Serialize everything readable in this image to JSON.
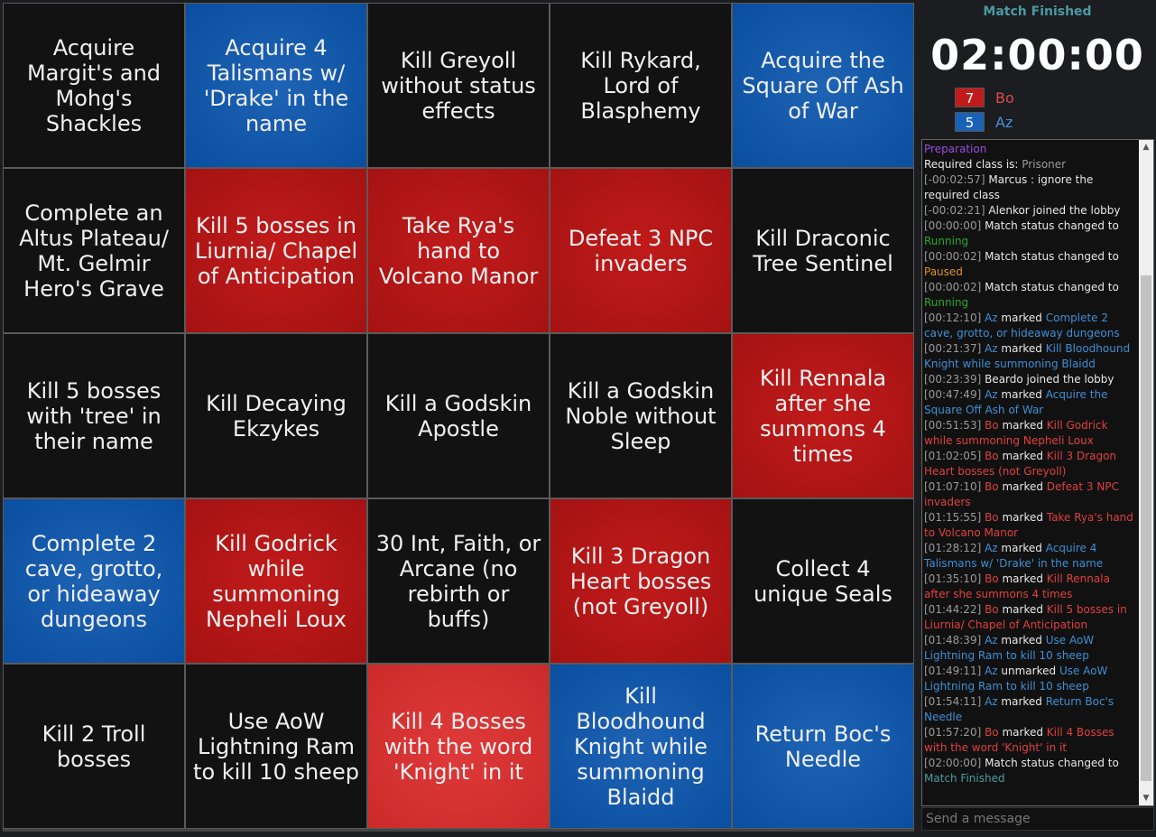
{
  "colors": {
    "red": "#c11b1b",
    "blue": "#0a4ea0",
    "none": "#121212"
  },
  "board": [
    {
      "text": "Acquire Margit's and Mohg's Shackles",
      "owner": "none"
    },
    {
      "text": "Acquire 4 Talismans w/ 'Drake' in the name",
      "owner": "blue"
    },
    {
      "text": "Kill Greyoll without status effects",
      "owner": "none"
    },
    {
      "text": "Kill Rykard, Lord of Blasphemy",
      "owner": "none"
    },
    {
      "text": "Acquire the Square Off Ash of War",
      "owner": "blue"
    },
    {
      "text": "Complete an Altus Plateau/ Mt. Gelmir Hero's Grave",
      "owner": "none"
    },
    {
      "text": "Kill 5 bosses in Liurnia/ Chapel of Anticipation",
      "owner": "red"
    },
    {
      "text": "Take Rya's hand to Volcano Manor",
      "owner": "red"
    },
    {
      "text": "Defeat 3 NPC invaders",
      "owner": "red"
    },
    {
      "text": "Kill Draconic Tree Sentinel",
      "owner": "none"
    },
    {
      "text": "Kill 5 bosses with 'tree' in their name",
      "owner": "none"
    },
    {
      "text": "Kill Decaying Ekzykes",
      "owner": "none"
    },
    {
      "text": "Kill a Godskin Apostle",
      "owner": "none"
    },
    {
      "text": "Kill a Godskin Noble without Sleep",
      "owner": "none"
    },
    {
      "text": "Kill Rennala after she summons 4 times",
      "owner": "red"
    },
    {
      "text": "Complete 2 cave, grotto, or hideaway dungeons",
      "owner": "blue"
    },
    {
      "text": "Kill Godrick while summoning Nepheli Loux",
      "owner": "red"
    },
    {
      "text": "30 Int, Faith, or Arcane (no rebirth or buffs)",
      "owner": "none"
    },
    {
      "text": "Kill 3 Dragon Heart bosses (not Greyoll)",
      "owner": "red"
    },
    {
      "text": "Collect 4 unique Seals",
      "owner": "none"
    },
    {
      "text": "Kill 2 Troll bosses",
      "owner": "none"
    },
    {
      "text": "Use AoW Lightning Ram to kill 10 sheep",
      "owner": "none"
    },
    {
      "text": "Kill 4 Bosses with the word 'Knight' in it",
      "owner": "red light"
    },
    {
      "text": "Kill Bloodhound Knight while summoning Blaidd",
      "owner": "blue"
    },
    {
      "text": "Return Boc's Needle",
      "owner": "blue"
    }
  ],
  "status": {
    "title": "Match Finished",
    "timer": "02:00:00"
  },
  "teams": {
    "bo": {
      "score": "7",
      "name": "Bo"
    },
    "az": {
      "score": "5",
      "name": "Az"
    }
  },
  "chat": {
    "placeholder": "Send a message",
    "messages": [
      {
        "parts": [
          {
            "t": "Preparation",
            "c": "prep"
          }
        ]
      },
      {
        "parts": [
          {
            "t": "Required class is: ",
            "c": ""
          },
          {
            "t": "Prisoner",
            "c": "muted"
          }
        ]
      },
      {
        "parts": [
          {
            "t": "[-00:02:57] ",
            "c": "ts"
          },
          {
            "t": "Marcus : ignore the required class",
            "c": ""
          }
        ]
      },
      {
        "parts": [
          {
            "t": "[-00:02:21] ",
            "c": "ts"
          },
          {
            "t": "Alenkor joined the lobby",
            "c": ""
          }
        ]
      },
      {
        "parts": [
          {
            "t": "[00:00:00] ",
            "c": "ts"
          },
          {
            "t": "Match status changed to ",
            "c": ""
          },
          {
            "t": "Running",
            "c": "st-run"
          }
        ]
      },
      {
        "parts": [
          {
            "t": "[00:00:02] ",
            "c": "ts"
          },
          {
            "t": "Match status changed to ",
            "c": ""
          },
          {
            "t": "Paused",
            "c": "st-pause"
          }
        ]
      },
      {
        "parts": [
          {
            "t": "[00:00:02] ",
            "c": "ts"
          },
          {
            "t": "Match status changed to ",
            "c": ""
          },
          {
            "t": "Running",
            "c": "st-run"
          }
        ]
      },
      {
        "parts": [
          {
            "t": "[00:12:10] ",
            "c": "ts"
          },
          {
            "t": "Az",
            "c": "n-az"
          },
          {
            "t": " marked ",
            "c": ""
          },
          {
            "t": "Complete 2 cave, grotto, or hideaway dungeons",
            "c": "o-az"
          }
        ]
      },
      {
        "parts": [
          {
            "t": "[00:21:37] ",
            "c": "ts"
          },
          {
            "t": "Az",
            "c": "n-az"
          },
          {
            "t": " marked ",
            "c": ""
          },
          {
            "t": "Kill Bloodhound Knight while summoning Blaidd",
            "c": "o-az"
          }
        ]
      },
      {
        "parts": [
          {
            "t": "[00:23:39] ",
            "c": "ts"
          },
          {
            "t": "Beardo joined the lobby",
            "c": ""
          }
        ]
      },
      {
        "parts": [
          {
            "t": "[00:47:49] ",
            "c": "ts"
          },
          {
            "t": "Az",
            "c": "n-az"
          },
          {
            "t": " marked ",
            "c": ""
          },
          {
            "t": "Acquire the Square Off Ash of War",
            "c": "o-az"
          }
        ]
      },
      {
        "parts": [
          {
            "t": "[00:51:53] ",
            "c": "ts"
          },
          {
            "t": "Bo",
            "c": "n-bo"
          },
          {
            "t": " marked ",
            "c": ""
          },
          {
            "t": "Kill Godrick while summoning Nepheli Loux",
            "c": "o-bo"
          }
        ]
      },
      {
        "parts": [
          {
            "t": "[01:02:05] ",
            "c": "ts"
          },
          {
            "t": "Bo",
            "c": "n-bo"
          },
          {
            "t": " marked ",
            "c": ""
          },
          {
            "t": "Kill 3 Dragon Heart bosses (not Greyoll)",
            "c": "o-bo"
          }
        ]
      },
      {
        "parts": [
          {
            "t": "[01:07:10] ",
            "c": "ts"
          },
          {
            "t": "Bo",
            "c": "n-bo"
          },
          {
            "t": " marked ",
            "c": ""
          },
          {
            "t": "Defeat 3 NPC invaders",
            "c": "o-bo"
          }
        ]
      },
      {
        "parts": [
          {
            "t": "[01:15:55] ",
            "c": "ts"
          },
          {
            "t": "Bo",
            "c": "n-bo"
          },
          {
            "t": " marked ",
            "c": ""
          },
          {
            "t": "Take Rya's hand to Volcano Manor",
            "c": "o-bo"
          }
        ]
      },
      {
        "parts": [
          {
            "t": "[01:28:12] ",
            "c": "ts"
          },
          {
            "t": "Az",
            "c": "n-az"
          },
          {
            "t": " marked ",
            "c": ""
          },
          {
            "t": "Acquire 4 Talismans w/ 'Drake' in the name",
            "c": "o-az"
          }
        ]
      },
      {
        "parts": [
          {
            "t": "[01:35:10] ",
            "c": "ts"
          },
          {
            "t": "Bo",
            "c": "n-bo"
          },
          {
            "t": " marked ",
            "c": ""
          },
          {
            "t": "Kill Rennala after she summons 4 times",
            "c": "o-bo"
          }
        ]
      },
      {
        "parts": [
          {
            "t": "[01:44:22] ",
            "c": "ts"
          },
          {
            "t": "Bo",
            "c": "n-bo"
          },
          {
            "t": " marked ",
            "c": ""
          },
          {
            "t": "Kill 5 bosses in Liurnia/ Chapel of Anticipation",
            "c": "o-bo"
          }
        ]
      },
      {
        "parts": [
          {
            "t": "[01:48:39] ",
            "c": "ts"
          },
          {
            "t": "Az",
            "c": "n-az"
          },
          {
            "t": " marked ",
            "c": ""
          },
          {
            "t": "Use AoW Lightning Ram to kill 10 sheep",
            "c": "o-az"
          }
        ]
      },
      {
        "parts": [
          {
            "t": "[01:49:11] ",
            "c": "ts"
          },
          {
            "t": "Az",
            "c": "n-az"
          },
          {
            "t": " unmarked ",
            "c": ""
          },
          {
            "t": "Use AoW Lightning Ram to kill 10 sheep",
            "c": "o-az"
          }
        ]
      },
      {
        "parts": [
          {
            "t": "[01:54:11] ",
            "c": "ts"
          },
          {
            "t": "Az",
            "c": "n-az"
          },
          {
            "t": " marked ",
            "c": ""
          },
          {
            "t": "Return Boc's Needle",
            "c": "o-az"
          }
        ]
      },
      {
        "parts": [
          {
            "t": "[01:57:20] ",
            "c": "ts"
          },
          {
            "t": "Bo",
            "c": "n-bo"
          },
          {
            "t": " marked ",
            "c": ""
          },
          {
            "t": "Kill 4 Bosses with the word 'Knight' in it",
            "c": "o-bo"
          }
        ]
      },
      {
        "parts": [
          {
            "t": "[02:00:00] ",
            "c": "ts"
          },
          {
            "t": "Match status changed to ",
            "c": ""
          },
          {
            "t": "Match Finished",
            "c": "st-fin"
          }
        ]
      }
    ]
  }
}
